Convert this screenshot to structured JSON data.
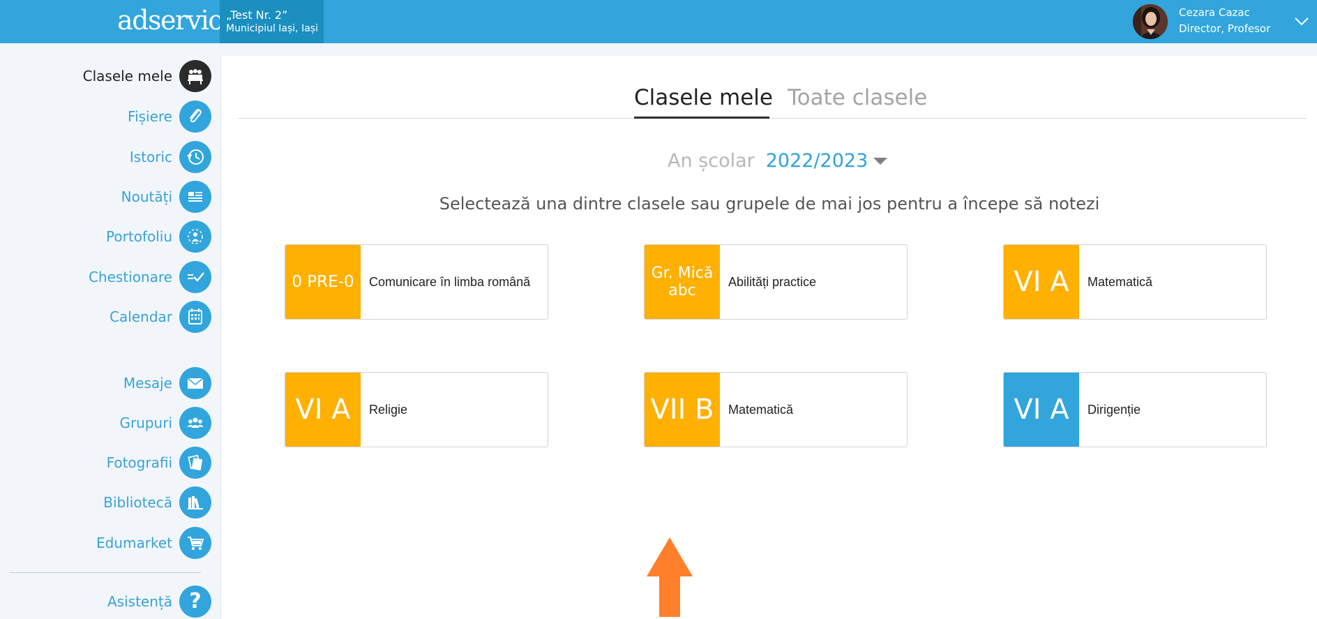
{
  "header": {
    "logo": "adservio",
    "school_name": "„Test Nr. 2”",
    "school_city": "Municipiul Iași, Iași",
    "user_name": "Cezara Cazac",
    "user_role": "Director, Profesor"
  },
  "sidebar": {
    "items": [
      {
        "label": "Clasele mele",
        "icon": "classroom-icon",
        "active": true
      },
      {
        "label": "Fișiere",
        "icon": "paperclip-icon"
      },
      {
        "label": "Istoric",
        "icon": "history-clock-icon"
      },
      {
        "label": "Noutăți",
        "icon": "news-icon"
      },
      {
        "label": "Portofoliu",
        "icon": "portfolio-icon"
      },
      {
        "label": "Chestionare",
        "icon": "survey-check-icon"
      },
      {
        "label": "Calendar",
        "icon": "calendar-icon"
      },
      {
        "label": "Mesaje",
        "icon": "envelope-icon"
      },
      {
        "label": "Grupuri",
        "icon": "group-icon"
      },
      {
        "label": "Fotografii",
        "icon": "photos-icon"
      },
      {
        "label": "Bibliotecă",
        "icon": "books-icon"
      },
      {
        "label": "Edumarket",
        "icon": "cart-icon"
      },
      {
        "label": "Asistență",
        "icon": "help-icon"
      }
    ],
    "help_glyph": "?"
  },
  "tabs": [
    {
      "label": "Clasele mele",
      "active": true
    },
    {
      "label": "Toate clasele",
      "active": false
    }
  ],
  "year": {
    "label": "An școlar",
    "value": "2022/2023"
  },
  "instruction": "Selectează una dintre clasele sau grupele de mai jos pentru a începe să notezi",
  "cards": [
    {
      "code": "0 PRE-0",
      "subject": "Comunicare în limba română",
      "color": "#ffb000"
    },
    {
      "code_line1": "Gr. Mică",
      "code_line2": "abc",
      "subject": "Abilități practice",
      "color": "#ffb000"
    },
    {
      "code": "VI A",
      "subject": "Matematică",
      "color": "#ffb000"
    },
    {
      "code": "VI A",
      "subject": "Religie",
      "color": "#ffb000"
    },
    {
      "code": "VII B",
      "subject": "Matematică",
      "color": "#ffb000"
    },
    {
      "code": "VI A",
      "subject": "Dirigenție",
      "color": "#31a5dc"
    }
  ],
  "colors": {
    "brand_blue": "#31a5dc",
    "school_box": "#1b8fbf",
    "class_orange": "#ffb000",
    "arrow_orange": "#ff7f2a"
  }
}
